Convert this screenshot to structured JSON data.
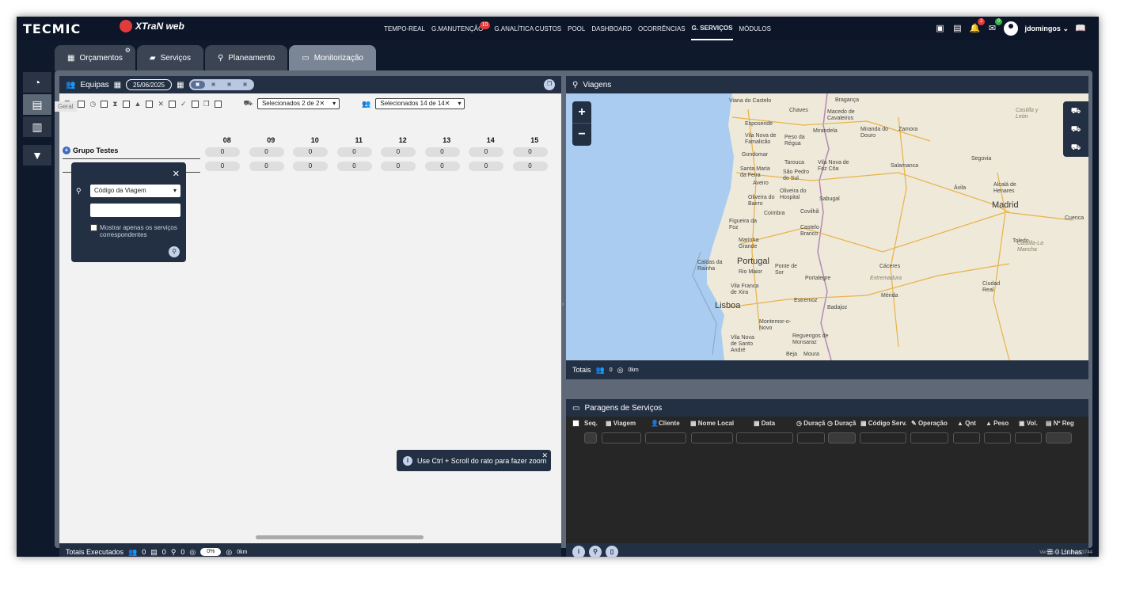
{
  "brand": {
    "logo_text": "TECMIC",
    "product_text": "XTraN web"
  },
  "nav": {
    "items": [
      {
        "label": "TEMPO-REAL"
      },
      {
        "label": "G.MANUTENÇÃO",
        "badge": "10"
      },
      {
        "label": "G.ANALÍTICA CUSTOS"
      },
      {
        "label": "POOL"
      },
      {
        "label": "DASHBOARD"
      },
      {
        "label": "OCORRÊNCIAS"
      },
      {
        "label": "G. SERVIÇOS",
        "active": true
      },
      {
        "label": "MÓDULOS"
      }
    ]
  },
  "topright": {
    "bell_badge": "2",
    "mail_badge": "0",
    "username": "jdomingos"
  },
  "tabs": [
    {
      "label": "Orçamentos"
    },
    {
      "label": "Serviços"
    },
    {
      "label": "Planeamento"
    },
    {
      "label": "Monitorização",
      "active": true
    }
  ],
  "sidebar": {
    "tooltip": "Geral"
  },
  "equipas": {
    "title": "Equipas",
    "date": "25/06/2025",
    "select_one": "Selecionados 2 de 2",
    "select_two": "Selecionados 14 de 14",
    "hours": [
      "08",
      "09",
      "10",
      "11",
      "12",
      "13",
      "14",
      "15"
    ],
    "group": "Grupo Testes",
    "row1": [
      "0",
      "0",
      "0",
      "0",
      "0",
      "0",
      "0",
      "0"
    ],
    "row2": [
      "0",
      "0",
      "0",
      "0",
      "0",
      "0",
      "0",
      "0"
    ]
  },
  "search_popup": {
    "select_label": "Código da Viagem",
    "checkbox_label": "Mostrar apenas os serviços correspondentes"
  },
  "toast": {
    "text": "Use Ctrl + Scroll do rato para fazer zoom"
  },
  "footer_left": {
    "label": "Totais Executados",
    "v1": "0",
    "v2": "0",
    "v3": "0",
    "percent": "0%",
    "km": "0km"
  },
  "viagens": {
    "title": "Viagens",
    "totals_label": "Totais",
    "totals_value": "0",
    "totals_km": "0km"
  },
  "map": {
    "cities": [
      "Viana do Castelo",
      "Bragança",
      "Chaves",
      "Macedo de Cavaleiros",
      "Castilla y León",
      "Esposende",
      "Mirandela",
      "Miranda do Douro",
      "Zamora",
      "Vila Nova de Famalicão",
      "Peso da Régua",
      "Gondomar",
      "Tarouca",
      "Vila Nova de Foz Côa",
      "Salamanca",
      "Santa Maria da Feira",
      "São Pedro do Sul",
      "Segovia",
      "Aveiro",
      "Oliveira do Hospital",
      "Sabugal",
      "Ávila",
      "Alcalá de Henares",
      "Oliveira do Bairro",
      "Coimbra",
      "Covilhã",
      "Madrid",
      "Figueira da Foz",
      "Castelo Branco",
      "Cuenca",
      "Marinha Grande",
      "Toledo",
      "Portugal",
      "Caldas da Rainha",
      "Rio Maior",
      "Ponte de Sor",
      "Cáceres",
      "Castilla-La Mancha",
      "Vila Franca de Xira",
      "Portalegre",
      "Extremadura",
      "Mérida",
      "Ciudad Real",
      "Lisboa",
      "Estremoz",
      "Badajoz",
      "Montemor-o-Novo",
      "Vila Nova de Santo André",
      "Reguengos de Monsaraz",
      "Beja",
      "Moura"
    ]
  },
  "paragens": {
    "title": "Paragens de Serviços",
    "columns": [
      "Seq.",
      "Viagem",
      "Cliente",
      "Nome Local",
      "Data",
      "Duraçã",
      "Duraçã",
      "Código Serv.",
      "Operação",
      "Qnt",
      "Peso",
      "Vol.",
      "Nº Reg"
    ],
    "lines": "0 Linhas"
  },
  "version": "Versão: 4.15.0.8eac3744",
  "colors": {
    "header": "#233044",
    "accent": "#3b6cc2",
    "badge": "#e23b3b"
  }
}
